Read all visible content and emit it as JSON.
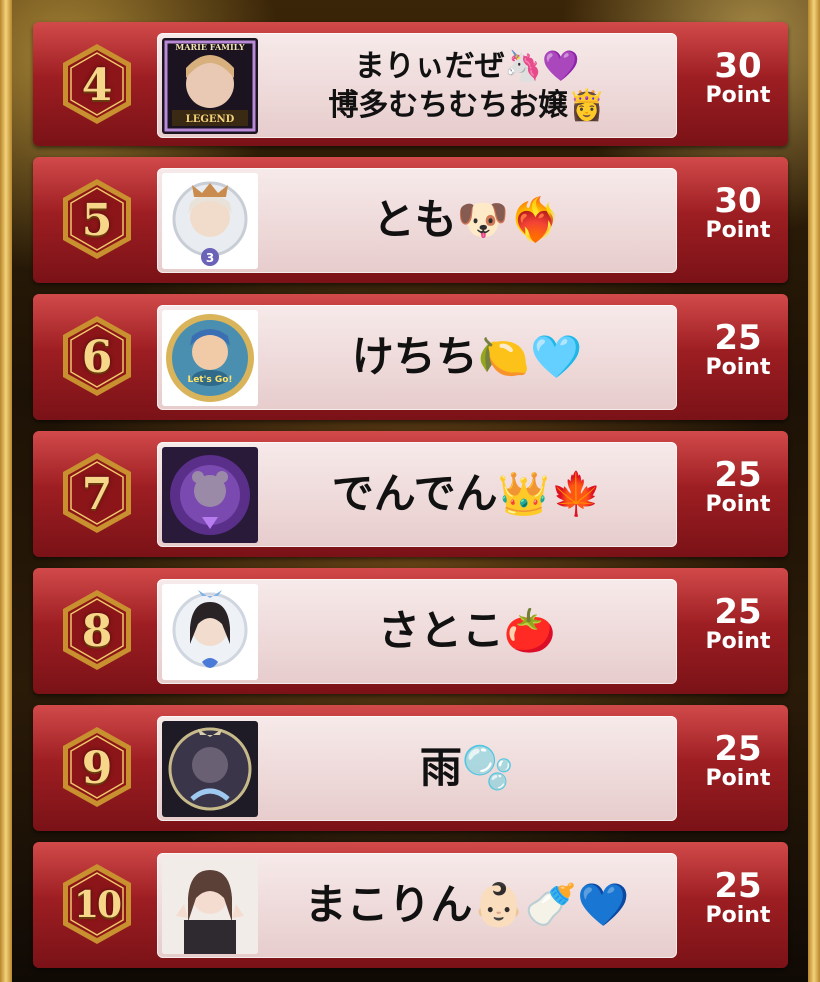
{
  "ranking": [
    {
      "rank": "4",
      "name_line1": "まりぃだぜ🦄💜",
      "name_line2": "博多むちむちお嬢👸",
      "points": "30",
      "point_label": "Point",
      "avatar_text": [
        "MARIE FAMILY",
        "LEGEND"
      ]
    },
    {
      "rank": "5",
      "name": "とも🐶❤️‍🔥",
      "points": "30",
      "point_label": "Point",
      "avatar_text": [
        "3"
      ]
    },
    {
      "rank": "6",
      "name": "けちち🍋🩵",
      "points": "25",
      "point_label": "Point",
      "avatar_text": [
        "Let's Go!"
      ]
    },
    {
      "rank": "7",
      "name": "でんでん👑🍁",
      "points": "25",
      "point_label": "Point"
    },
    {
      "rank": "8",
      "name": "さとこ🍅",
      "points": "25",
      "point_label": "Point"
    },
    {
      "rank": "9",
      "name": "雨🫧",
      "points": "25",
      "point_label": "Point"
    },
    {
      "rank": "10",
      "name": "まこりん👶🏻🍼💙",
      "points": "25",
      "point_label": "Point"
    }
  ],
  "colors": {
    "row_top": "#d24a4a",
    "row_bottom": "#7a1217",
    "gold": "#f6d78a",
    "card": "#f1dede"
  }
}
